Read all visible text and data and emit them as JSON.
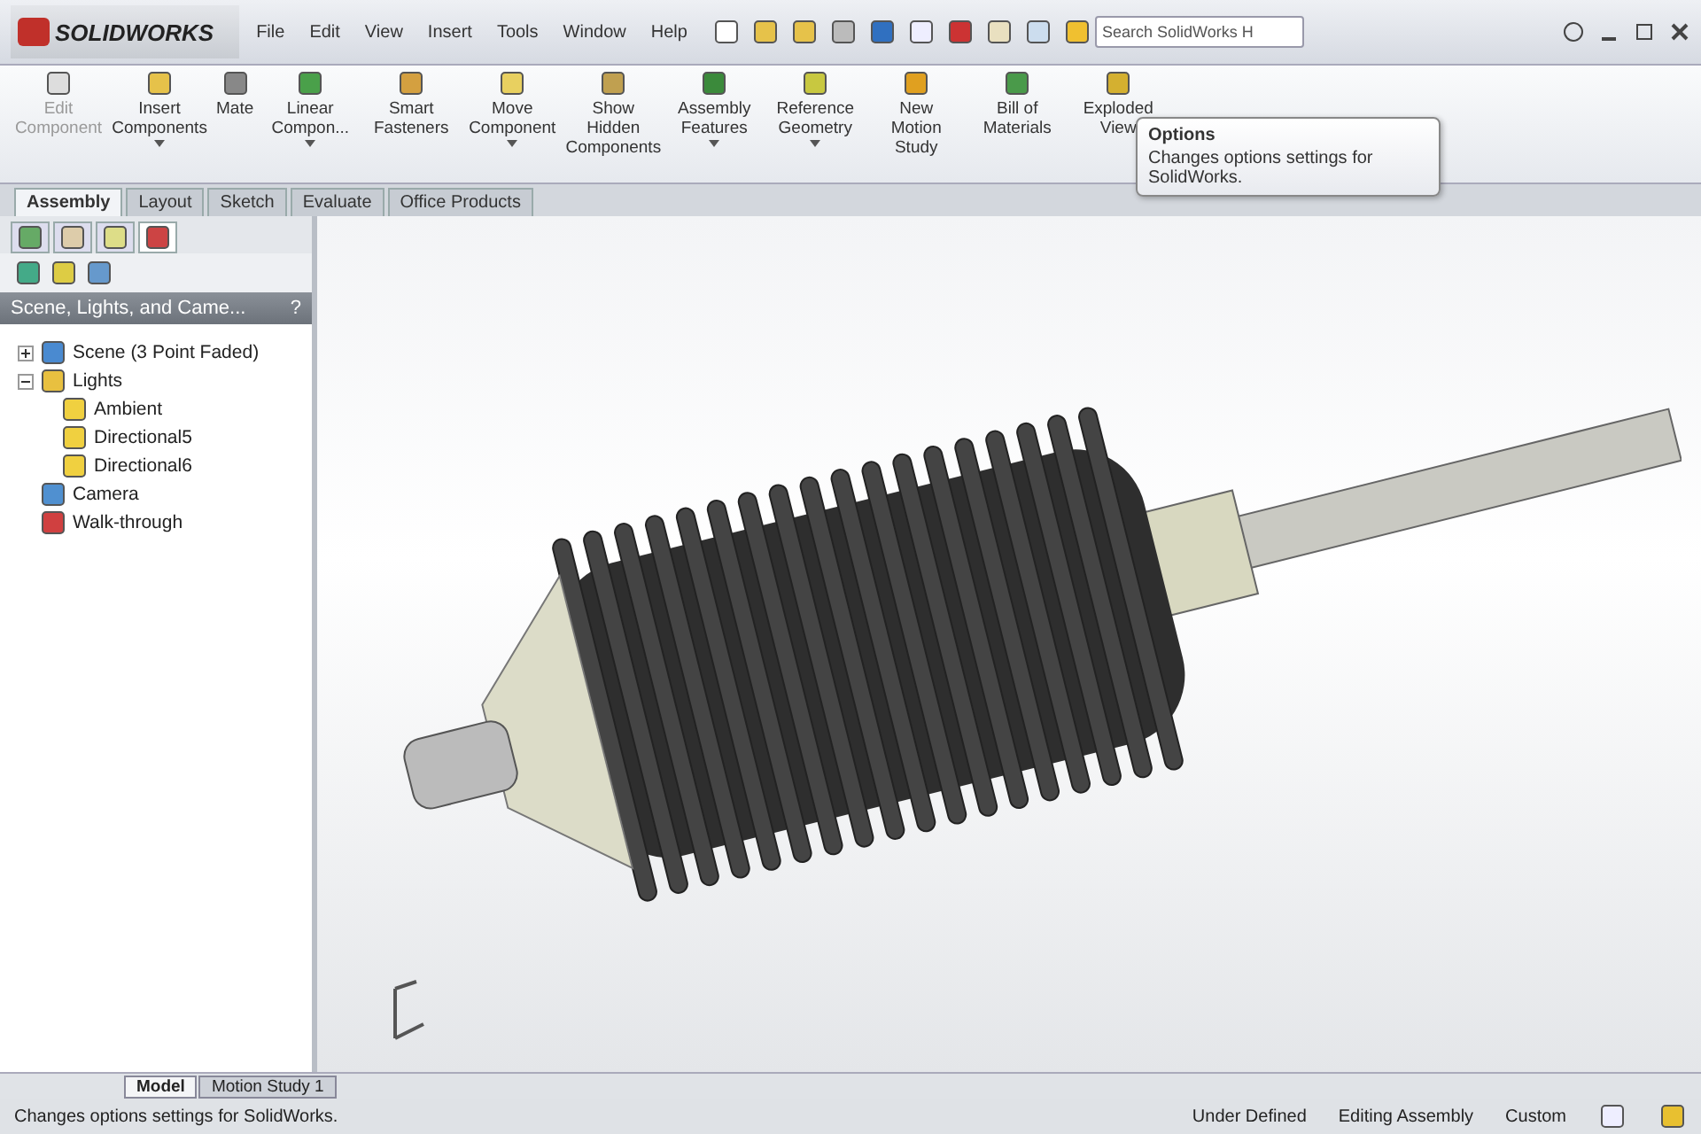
{
  "app": {
    "logo": "SOLIDWORKS"
  },
  "menu": [
    "File",
    "Edit",
    "View",
    "Insert",
    "Tools",
    "Window",
    "Help"
  ],
  "search": {
    "placeholder": "Search SolidWorks H"
  },
  "ribbon": [
    {
      "label": "Edit Component",
      "disabled": true,
      "has_menu": false
    },
    {
      "label": "Insert Components",
      "disabled": false,
      "has_menu": true
    },
    {
      "label": "Mate",
      "disabled": false,
      "has_menu": false
    },
    {
      "label": "Linear Compon...",
      "disabled": false,
      "has_menu": true
    },
    {
      "label": "Smart Fasteners",
      "disabled": false,
      "has_menu": false
    },
    {
      "label": "Move Component",
      "disabled": false,
      "has_menu": true
    },
    {
      "label": "Show Hidden Components",
      "disabled": false,
      "has_menu": false
    },
    {
      "label": "Assembly Features",
      "disabled": false,
      "has_menu": true
    },
    {
      "label": "Reference Geometry",
      "disabled": false,
      "has_menu": true
    },
    {
      "label": "New Motion Study",
      "disabled": false,
      "has_menu": false
    },
    {
      "label": "Bill of Materials",
      "disabled": false,
      "has_menu": false
    },
    {
      "label": "Exploded View",
      "disabled": false,
      "has_menu": false
    }
  ],
  "tooltip": {
    "title": "Options",
    "text": "Changes options settings for SolidWorks."
  },
  "tabs": [
    {
      "label": "Assembly",
      "selected": true
    },
    {
      "label": "Layout",
      "selected": false
    },
    {
      "label": "Sketch",
      "selected": false
    },
    {
      "label": "Evaluate",
      "selected": false
    },
    {
      "label": "Office Products",
      "selected": false
    }
  ],
  "panel_tabs": [
    {
      "selected": false
    },
    {
      "selected": false
    },
    {
      "selected": false
    },
    {
      "selected": true
    }
  ],
  "panel": {
    "title": "Scene, Lights, and Came...",
    "help": "?",
    "tree": [
      {
        "label": "Scene (3 Point Faded)",
        "expanded": false
      },
      {
        "label": "Lights",
        "expanded": true,
        "children": [
          {
            "label": "Ambient"
          },
          {
            "label": "Directional5"
          },
          {
            "label": "Directional6"
          }
        ]
      },
      {
        "label": "Camera"
      },
      {
        "label": "Walk-through"
      }
    ]
  },
  "bottom_tabs": [
    {
      "label": "Model",
      "selected": true
    },
    {
      "label": "Motion Study 1",
      "selected": false
    }
  ],
  "status_bar": {
    "message": "Changes options settings for SolidWorks.",
    "state": "Under Defined",
    "mode": "Editing Assembly",
    "units": "Custom"
  }
}
